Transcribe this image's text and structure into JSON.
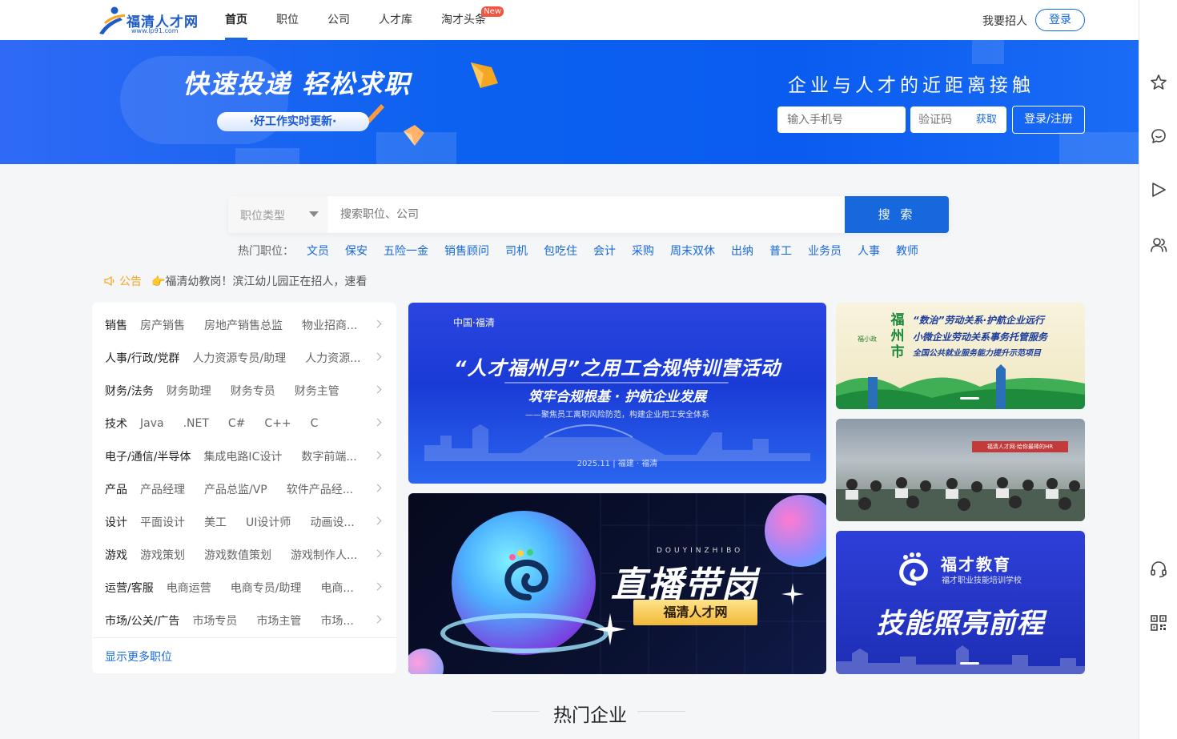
{
  "header": {
    "logo_name": "福清人才网",
    "logo_url": "www.lp91.com",
    "nav": [
      {
        "label": "首页",
        "active": true
      },
      {
        "label": "职位",
        "active": false
      },
      {
        "label": "公司",
        "active": false
      },
      {
        "label": "人才库",
        "active": false
      },
      {
        "label": "淘才头条",
        "active": false,
        "badge": "New"
      }
    ],
    "recruit_label": "我要招人",
    "login_label": "登录"
  },
  "banner": {
    "headline": "快速投递 轻松求职",
    "pill": "·好工作实时更新·",
    "slogan": "企业与人才的近距离接触",
    "phone_placeholder": "输入手机号",
    "code_placeholder": "验证码",
    "get_code_label": "获取",
    "login_register_label": "登录/注册"
  },
  "search": {
    "job_type_label": "职位类型",
    "placeholder": "搜索职位、公司",
    "button_label": "搜 索",
    "hot_label": "热门职位：",
    "hot_items": [
      "文员",
      "保安",
      "五险一金",
      "销售顾问",
      "司机",
      "包吃住",
      "会计",
      "采购",
      "周末双休",
      "出纳",
      "普工",
      "业务员",
      "人事",
      "教师"
    ]
  },
  "notice": {
    "label": "公告",
    "text": "👉福清幼教岗！滨江幼儿园正在招人，速看"
  },
  "categories": [
    {
      "name": "销售",
      "subs": [
        "房产销售",
        "房地产销售总监",
        "物业招商..."
      ]
    },
    {
      "name": "人事/行政/党群",
      "subs": [
        "人力资源专员/助理",
        "人力资源..."
      ]
    },
    {
      "name": "财务/法务",
      "subs": [
        "财务助理",
        "财务专员",
        "财务主管"
      ]
    },
    {
      "name": "技术",
      "subs": [
        "Java",
        ".NET",
        "C#",
        "C++",
        "C"
      ]
    },
    {
      "name": "电子/通信/半导体",
      "subs": [
        "集成电路IC设计",
        "数字前端..."
      ]
    },
    {
      "name": "产品",
      "subs": [
        "产品经理",
        "产品总监/VP",
        "软件产品经..."
      ]
    },
    {
      "name": "设计",
      "subs": [
        "平面设计",
        "美工",
        "UI设计师",
        "动画设..."
      ]
    },
    {
      "name": "游戏",
      "subs": [
        "游戏策划",
        "游戏数值策划",
        "游戏制作人..."
      ]
    },
    {
      "name": "运营/客服",
      "subs": [
        "电商运营",
        "电商专员/助理",
        "电商..."
      ]
    },
    {
      "name": "市场/公关/广告",
      "subs": [
        "市场专员",
        "市场主管",
        "市场..."
      ]
    }
  ],
  "categories_more_label": "显示更多职位",
  "promo": {
    "a": {
      "logos": "中国·福清",
      "title": "“人才福州月”之用工合规特训营活动",
      "subtitle": "筑牢合规根基 · 护航企业发展",
      "subtitle2": "——聚焦员工离职风险防范，构建企业用工安全体系",
      "date": "2025.11 | 福建 · 福清"
    },
    "b": {
      "pinyin": "DOUYINZHIBO",
      "title": "直播带岗",
      "tag": "福清人才网"
    },
    "c": {
      "logo": "福小政",
      "city": "福州市",
      "line1": "“数治”劳动关系·护航企业远行",
      "line2": "小微企业劳动关系事务托管服务",
      "line3": "全国公共就业服务能力提升示范项目"
    },
    "d": {
      "banner": "福清人才网·给你最棒的HR"
    },
    "e": {
      "name": "福才教育",
      "sub": "福才职业技能培训学校",
      "title": "技能照亮前程"
    }
  },
  "section": {
    "title": "热门企业"
  },
  "rail": [
    "star-icon",
    "chat-icon",
    "send-icon",
    "users-icon",
    "headset-icon",
    "qrcode-icon"
  ],
  "colors": {
    "primary": "#1668dc",
    "banner": "#0c61f0",
    "notice": "#f5a623",
    "badge": "#f5543f"
  }
}
